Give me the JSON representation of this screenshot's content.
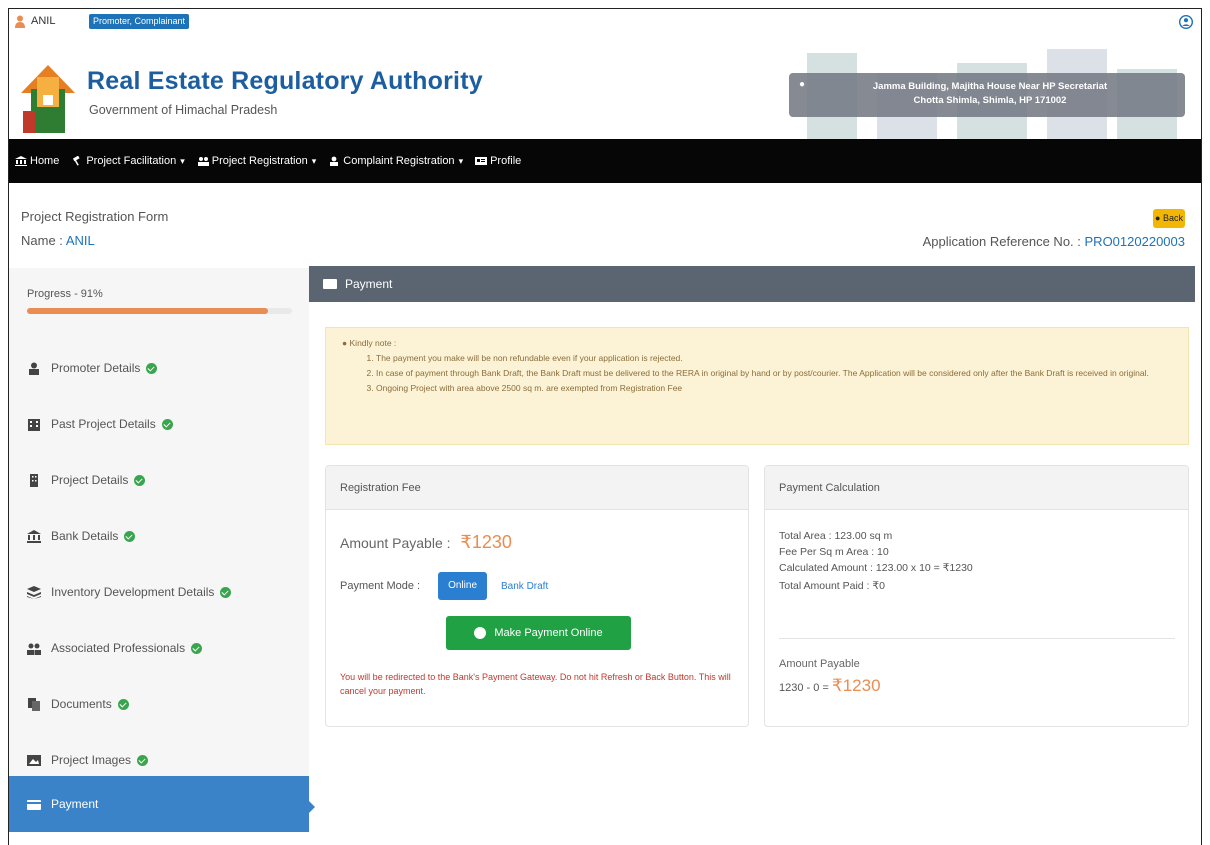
{
  "topbar": {
    "user_name": "ANIL",
    "role_badge": "Promoter, Complainant"
  },
  "header": {
    "title": "Real Estate Regulatory Authority",
    "subtitle": "Government of Himachal Pradesh",
    "address_line1": "Jamma Building, Majitha House Near HP Secretariat",
    "address_line2": "Chotta Shimla, Shimla, HP 171002"
  },
  "navbar": {
    "items": [
      {
        "label": "Home",
        "icon": "bank-icon",
        "dropdown": false
      },
      {
        "label": "Project Facilitation",
        "icon": "gavel-icon",
        "dropdown": true
      },
      {
        "label": "Project Registration",
        "icon": "users-icon",
        "dropdown": true
      },
      {
        "label": "Complaint Registration",
        "icon": "user-icon",
        "dropdown": true
      },
      {
        "label": "Profile",
        "icon": "id-card-icon",
        "dropdown": false
      }
    ]
  },
  "page": {
    "form_title": "Project Registration Form",
    "name_label": "Name :",
    "name_value": "ANIL",
    "back_label": "Back",
    "app_ref_label": "Application Reference No. :",
    "app_ref_value": "PRO0120220003"
  },
  "sidebar": {
    "progress_label": "Progress - 91%",
    "progress_value": 0.91,
    "items": [
      {
        "label": "Promoter Details",
        "icon": "user-icon",
        "complete": true,
        "active": false
      },
      {
        "label": "Past Project Details",
        "icon": "building-icon",
        "complete": true,
        "active": false
      },
      {
        "label": "Project Details",
        "icon": "building-icon",
        "complete": true,
        "active": false
      },
      {
        "label": "Bank Details",
        "icon": "bank-icon",
        "complete": true,
        "active": false
      },
      {
        "label": "Inventory Development Details",
        "icon": "layers-icon",
        "complete": true,
        "active": false
      },
      {
        "label": "Associated Professionals",
        "icon": "users-icon",
        "complete": true,
        "active": false
      },
      {
        "label": "Documents",
        "icon": "files-icon",
        "complete": true,
        "active": false
      },
      {
        "label": "Project Images",
        "icon": "image-icon",
        "complete": true,
        "active": false
      },
      {
        "label": "Payment",
        "icon": "card-icon",
        "complete": false,
        "active": true
      }
    ]
  },
  "main": {
    "section_title": "Payment",
    "note": {
      "heading": "Kindly note :",
      "items": [
        "The payment you make will be non refundable even if your application is rejected.",
        "In case of payment through Bank Draft, the Bank Draft must be delivered to the RERA in original by hand or by post/courier. The Application will be considered only after the Bank Draft is received in original.",
        "Ongoing Project with area above 2500 sq m. are exempted from Registration Fee"
      ]
    },
    "registration_fee": {
      "title": "Registration Fee",
      "amount_label": "Amount Payable :",
      "amount_value": "₹1230",
      "mode_label": "Payment Mode :",
      "mode_online": "Online",
      "mode_dd": "Bank Draft",
      "pay_button": "Make Payment Online",
      "redirect_note": "You will be redirected to the Bank's Payment Gateway. Do not hit Refresh or Back Button. This will cancel your payment."
    },
    "calculation": {
      "title": "Payment Calculation",
      "total_area": "Total Area : 123.00 sq m",
      "fee_per_sqm": "Fee Per Sq m Area : 10",
      "calculated": "Calculated Amount : 123.00 x 10 = ₹1230",
      "total_paid": "Total Amount Paid : ₹0",
      "payable_label": "Amount Payable",
      "payable_formula": "1230 - 0 =",
      "payable_value": "₹1230"
    }
  },
  "colors": {
    "brand_blue": "#1c5e9f",
    "navbar_bg": "#060606",
    "active_blue": "#3b83c8",
    "progress_orange": "#e98d52",
    "success_green": "#1fa144",
    "note_bg": "#fcf3d6"
  }
}
